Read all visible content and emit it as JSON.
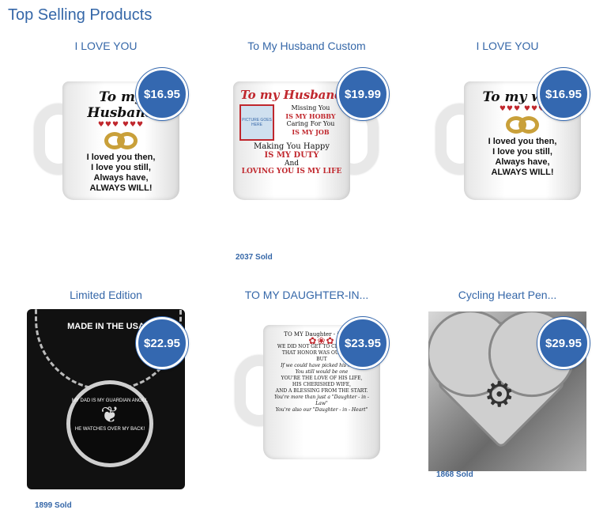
{
  "heading": "Top Selling Products",
  "products": [
    {
      "title": "I LOVE YOU",
      "price": "$16.95",
      "sold": "",
      "mug_title": "To my Husband",
      "mug_lines": [
        "I loved you then,",
        "I love you still,",
        "Always have,",
        "ALWAYS WILL!"
      ]
    },
    {
      "title": "To My Husband Custom",
      "price": "$19.99",
      "sold": "2037 Sold",
      "mug_title": "To my Husband",
      "mug_lines": [
        "Missing You",
        "IS MY HOBBY",
        "Caring For You",
        "IS MY JOB",
        "Making You Happy",
        "IS MY DUTY",
        "And",
        "LOVING YOU IS MY LIFE"
      ],
      "photo_label": "PICTURE GOES HERE"
    },
    {
      "title": "I LOVE YOU",
      "price": "$16.95",
      "sold": "",
      "mug_title": "To my wife",
      "mug_lines": [
        "I loved you then,",
        "I love you still,",
        "Always have,",
        "ALWAYS WILL!"
      ]
    },
    {
      "title": "Limited Edition",
      "price": "$22.95",
      "sold": "1899 Sold",
      "made_label": "MADE IN THE USA",
      "pendant_top": "MY DAD IS MY GUARDIAN ANGEL",
      "pendant_bottom": "HE WATCHES OVER MY BACK!"
    },
    {
      "title": "TO MY DAUGHTER-IN...",
      "price": "$23.95",
      "sold": "",
      "mug_title": "TO MY Daughter - in - Law",
      "mug_lines": [
        "WE DID NOT GET TO CHOOSE YOU",
        "THAT HONOR WAS OUR SON'S.",
        "BUT",
        "If we could have picked his match",
        "You still would be one",
        "YOU'RE THE LOVE OF HIS LIFE,",
        "HIS CHERISHED WIFE,",
        "AND A BLESSING FROM THE START.",
        "You're more than just a \"Daughter - in - Law\"",
        "You're also our \"Daughter - in - Heart\""
      ]
    },
    {
      "title": "Cycling Heart Pen...",
      "price": "$29.95",
      "sold": "1868 Sold"
    }
  ],
  "colors": {
    "accent": "#3567a8",
    "badge": "#3468b0"
  }
}
